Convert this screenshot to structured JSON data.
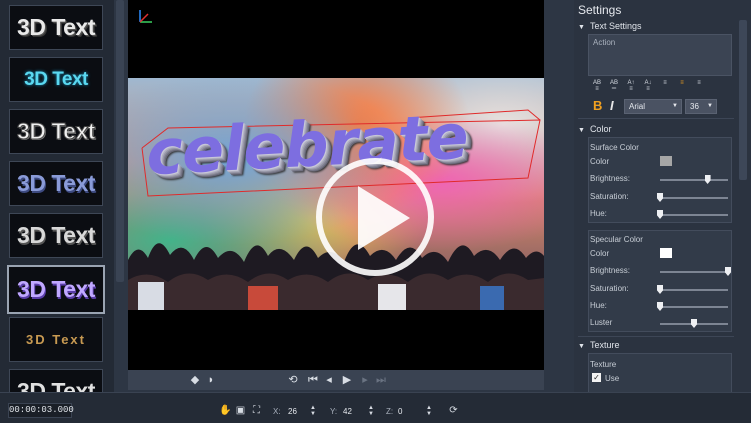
{
  "presets": {
    "items": [
      {
        "label": "3D Text"
      },
      {
        "label": "3D Text"
      },
      {
        "label": "3D Text"
      },
      {
        "label": "3D Text"
      },
      {
        "label": "3D Text"
      },
      {
        "label": "3D Text"
      },
      {
        "label": "3D Text"
      },
      {
        "label": "3D Text"
      }
    ],
    "selected_index": 5
  },
  "preview": {
    "title_text": "celebrate"
  },
  "settings": {
    "title": "Settings",
    "text_settings": {
      "header": "Text Settings",
      "action_placeholder": "Action",
      "bold_label": "B",
      "italic_label": "I",
      "font": "Arial",
      "size": "36"
    },
    "color": {
      "header": "Color",
      "surface": {
        "title": "Surface Color",
        "color_label": "Color",
        "color_value": "#a6a6a6",
        "brightness_label": "Brightness:",
        "brightness": 0.7,
        "saturation_label": "Saturation:",
        "saturation": 0.0,
        "hue_label": "Hue:",
        "hue": 0.0
      },
      "specular": {
        "title": "Specular Color",
        "color_label": "Color",
        "color_value": "#ffffff",
        "brightness_label": "Brightness:",
        "brightness": 1.0,
        "saturation_label": "Saturation:",
        "saturation": 0.0,
        "hue_label": "Hue:",
        "hue": 0.0,
        "luster_label": "Luster",
        "luster": 0.5
      }
    },
    "texture": {
      "header": "Texture",
      "title": "Texture",
      "use_label": "Use",
      "use_checked": true
    }
  },
  "bottom": {
    "timecode": "00:00:03.000",
    "x_label": "X:",
    "x_value": "26",
    "y_label": "Y:",
    "y_value": "42",
    "z_label": "Z:",
    "z_value": "0"
  }
}
